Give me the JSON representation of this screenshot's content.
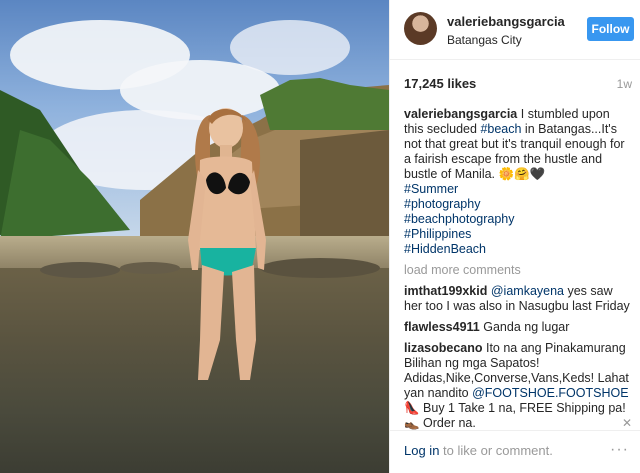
{
  "post": {
    "username": "valeriebangsgarcia",
    "location": "Batangas City",
    "follow_label": "Follow",
    "likes": "17,245 likes",
    "age": "1w",
    "caption_user": "valeriebangsgarcia",
    "caption_a": "I stumbled upon this secluded ",
    "caption_tag_beach": "#beach",
    "caption_b": " in Batangas...It's not that great but it's tranquil enough for a fairish escape from the hustle and bustle of Manila.",
    "caption_emoji": "🌼🤗🖤",
    "hashtags": [
      "#Summer",
      "#photography",
      "#beachphotography",
      "#Philippines",
      "#HiddenBeach"
    ],
    "load_more": "load more comments"
  },
  "comments": [
    {
      "user": "imthat199xkid",
      "mention": "@iamkayena",
      "text": " yes saw her too I was also in Nasugbu last Friday"
    },
    {
      "user": "flawless4911",
      "text": "Ganda ng lugar"
    },
    {
      "user": "lizasobecano",
      "text": "Ito na ang Pinakamurang Bilihan ng mga Sapatos! Adidas,Nike,Converse,Vans,Keds! Lahat yan nandito ",
      "mention": "@FOOTSHOE.FOOTSHOE",
      "text2": " 👠 Buy 1 Take 1 na, FREE Shipping pa!👞 Order na.",
      "flag": "✕"
    }
  ],
  "footer": {
    "login_link": "Log in",
    "login_rest": " to like or comment.",
    "more_icon": "more-options-icon",
    "more_glyph": "···"
  }
}
